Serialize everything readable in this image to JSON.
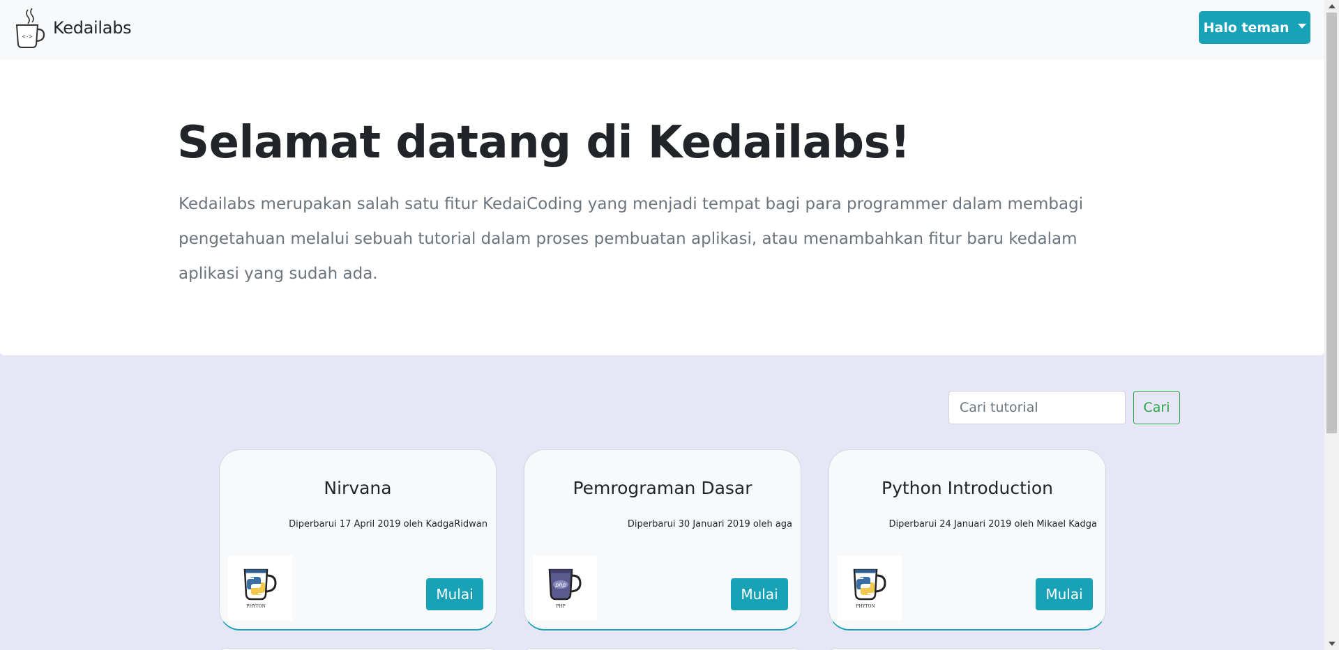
{
  "navbar": {
    "brand_name": "Kedailabs",
    "user_menu_label": "Halo teman"
  },
  "hero": {
    "title": "Selamat datang di Kedailabs!",
    "lead": "Kedailabs merupakan salah satu fitur KedaiCoding yang menjadi tempat bagi para programmer dalam membagi pengetahuan melalui sebuah tutorial dalam proses pembuatan aplikasi, atau menambahkan fitur baru kedalam aplikasi yang sudah ada."
  },
  "search": {
    "placeholder": "Cari tutorial",
    "button_label": "Cari"
  },
  "cards": [
    {
      "title": "Nirvana",
      "meta": "Diperbarui 17 April 2019 oleh KadgaRidwan",
      "image_label": "PHYTON",
      "image_icon": "python-mug-icon",
      "button_label": "Mulai"
    },
    {
      "title": "Pemrograman Dasar",
      "meta": "Diperbarui 30 Januari 2019 oleh aga",
      "image_label": "PHP",
      "image_icon": "php-mug-icon",
      "button_label": "Mulai"
    },
    {
      "title": "Python Introduction",
      "meta": "Diperbarui 24 Januari 2019 oleh Mikael Kadga",
      "image_label": "PHYTON",
      "image_icon": "python-mug-icon",
      "button_label": "Mulai"
    }
  ],
  "colors": {
    "primary": "#17a2b8",
    "success": "#28a745",
    "page_background": "#e6e6f7"
  }
}
